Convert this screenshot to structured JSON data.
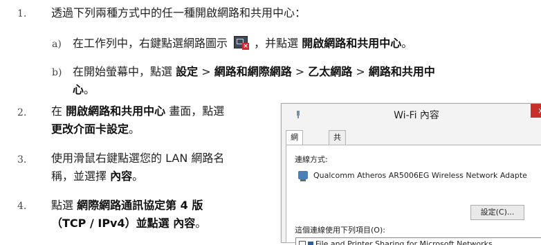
{
  "steps": [
    {
      "num": "1.",
      "text": "透過下列兩種方式中的任一種開啟網路和共用中心："
    },
    {
      "num": "2.",
      "line1_a": "在 ",
      "line1_b": "開啟網路和共用中心",
      "line1_c": " 畫面，點選",
      "line2": "更改介面卡設定",
      "line2_c": "。"
    },
    {
      "num": "3.",
      "line1": "使用滑鼠右鍵點選您的 LAN 網路名",
      "line2_a": "稱，並選擇 ",
      "line2_b": "內容",
      "line2_c": "。"
    },
    {
      "num": "4.",
      "line1_a": "點選 ",
      "line1_b": "網際網路通訊協定第 4 版",
      "line2_a": "（TCP / IPv4）並點選 ",
      "line2_b": "內容",
      "line2_c": "。"
    }
  ],
  "substeps": [
    {
      "num": "a)",
      "t1": "在工作列中，右鍵點選網路圖示 ",
      "icon": "network-error-icon",
      "t2": " ，并點選 ",
      "t3": "開啟網路和共用中心",
      "t4": "。"
    },
    {
      "num": "b)",
      "t1": "在開始螢幕中，點選 ",
      "t2": "設定",
      "sep": " > ",
      "t3": "網路和網際網路",
      "t4": "乙太網路",
      "t5": "網路和共用中",
      "t6": "心",
      "t7": "。"
    }
  ],
  "dialog": {
    "title": "Wi-Fi 內容",
    "close": "×",
    "tabs": [
      "網路功能",
      "共用"
    ],
    "connect_using_label": "連線方式:",
    "adapter_name": "Qualcomm Atheros AR5006EG Wireless Network Adapte",
    "configure_button": "設定(C)...",
    "items_label": "這個連線使用下列項目(O):",
    "first_item": "File and Printer Sharing for Microsoft Networks"
  },
  "colors": {
    "close_red": "#c7302a",
    "icon_red": "#d8272e"
  }
}
